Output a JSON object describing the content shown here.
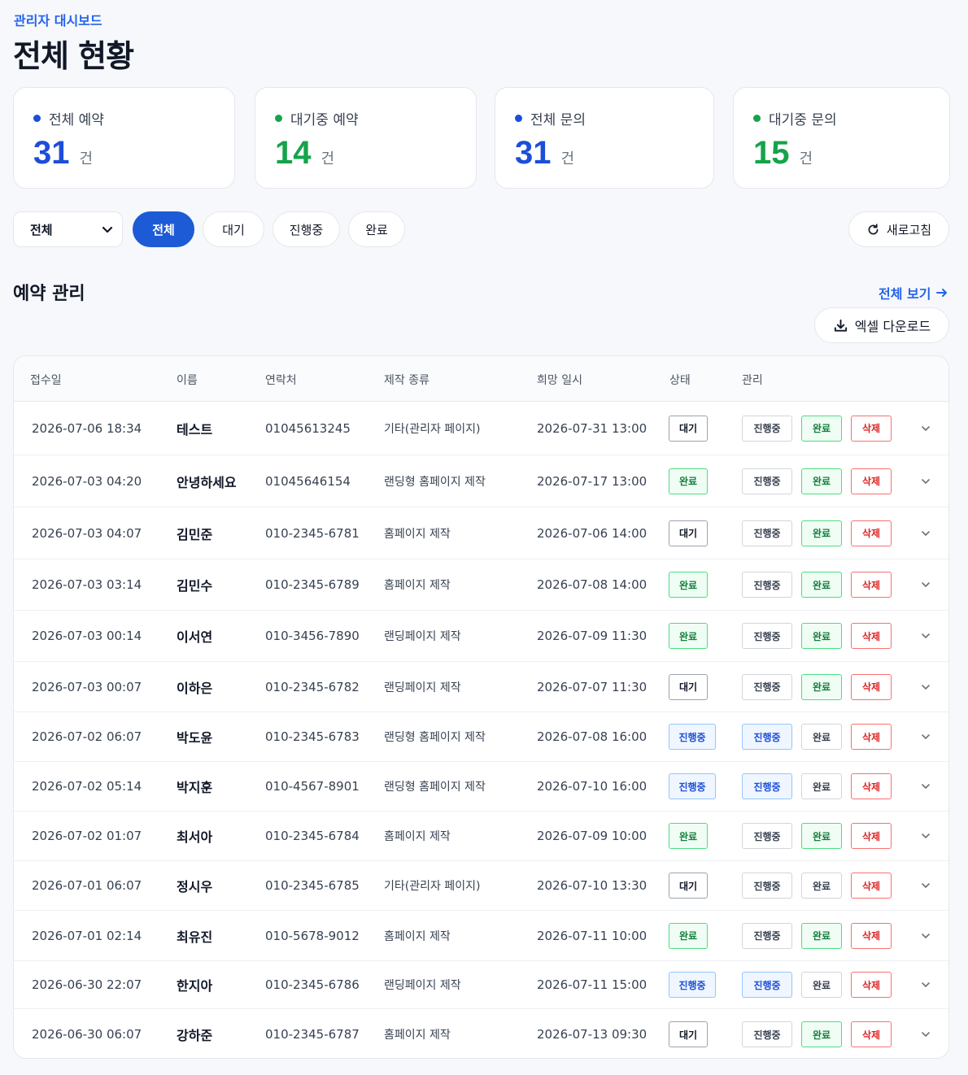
{
  "header": {
    "eyebrow": "관리자 대시보드",
    "title": "전체 현황"
  },
  "stats": [
    {
      "label": "전체 예약",
      "value": "31",
      "unit": "건",
      "color": "#1d4ed8"
    },
    {
      "label": "대기중 예약",
      "value": "14",
      "unit": "건",
      "color": "#16a34a"
    },
    {
      "label": "전체 문의",
      "value": "31",
      "unit": "건",
      "color": "#1d4ed8"
    },
    {
      "label": "대기중 문의",
      "value": "15",
      "unit": "건",
      "color": "#16a34a"
    }
  ],
  "filters": {
    "select_value": "전체",
    "pills": [
      "전체",
      "대기",
      "진행중",
      "완료"
    ],
    "active": "전체",
    "refresh_label": "새로고침"
  },
  "section": {
    "title": "예약 관리",
    "view_all": "전체 보기",
    "excel": "엑셀 다운로드"
  },
  "table": {
    "headers": [
      "접수일",
      "이름",
      "연락처",
      "제작 종류",
      "희망 일시",
      "상태",
      "관리"
    ],
    "actions": {
      "progress": "진행중",
      "done": "완료",
      "delete": "삭제"
    },
    "rows": [
      {
        "date": "2026-07-06 18:34",
        "name": "테스트",
        "phone": "01045613245",
        "kind": "기타(관리자 페이지)",
        "wish": "2026-07-31 13:00",
        "status": "대기",
        "s": "wait"
      },
      {
        "date": "2026-07-03 04:20",
        "name": "안녕하세요",
        "phone": "01045646154",
        "kind": "랜딩형 홈페이지 제작",
        "wish": "2026-07-17 13:00",
        "status": "완료",
        "s": "done"
      },
      {
        "date": "2026-07-03 04:07",
        "name": "김민준",
        "phone": "010-2345-6781",
        "kind": "홈페이지 제작",
        "wish": "2026-07-06 14:00",
        "status": "대기",
        "s": "wait"
      },
      {
        "date": "2026-07-03 03:14",
        "name": "김민수",
        "phone": "010-2345-6789",
        "kind": "홈페이지 제작",
        "wish": "2026-07-08 14:00",
        "status": "완료",
        "s": "done"
      },
      {
        "date": "2026-07-03 00:14",
        "name": "이서연",
        "phone": "010-3456-7890",
        "kind": "랜딩페이지 제작",
        "wish": "2026-07-09 11:30",
        "status": "완료",
        "s": "done"
      },
      {
        "date": "2026-07-03 00:07",
        "name": "이하은",
        "phone": "010-2345-6782",
        "kind": "랜딩페이지 제작",
        "wish": "2026-07-07 11:30",
        "status": "대기",
        "s": "wait"
      },
      {
        "date": "2026-07-02 06:07",
        "name": "박도윤",
        "phone": "010-2345-6783",
        "kind": "랜딩형 홈페이지 제작",
        "wish": "2026-07-08 16:00",
        "status": "진행중",
        "s": "prog"
      },
      {
        "date": "2026-07-02 05:14",
        "name": "박지훈",
        "phone": "010-4567-8901",
        "kind": "랜딩형 홈페이지 제작",
        "wish": "2026-07-10 16:00",
        "status": "진행중",
        "s": "prog"
      },
      {
        "date": "2026-07-02 01:07",
        "name": "최서아",
        "phone": "010-2345-6784",
        "kind": "홈페이지 제작",
        "wish": "2026-07-09 10:00",
        "status": "완료",
        "s": "done"
      },
      {
        "date": "2026-07-01 06:07",
        "name": "정시우",
        "phone": "010-2345-6785",
        "kind": "기타(관리자 페이지)",
        "wish": "2026-07-10 13:30",
        "status": "대기",
        "s": "wait"
      },
      {
        "date": "2026-07-01 02:14",
        "name": "최유진",
        "phone": "010-5678-9012",
        "kind": "홈페이지 제작",
        "wish": "2026-07-11 10:00",
        "status": "완료",
        "s": "done"
      },
      {
        "date": "2026-06-30 22:07",
        "name": "한지아",
        "phone": "010-2345-6786",
        "kind": "랜딩페이지 제작",
        "wish": "2026-07-11 15:00",
        "status": "진행중",
        "s": "prog"
      },
      {
        "date": "2026-06-30 06:07",
        "name": "강하준",
        "phone": "010-2345-6787",
        "kind": "홈페이지 제작",
        "wish": "2026-07-13 09:30",
        "status": "대기",
        "s": "wait"
      }
    ]
  }
}
